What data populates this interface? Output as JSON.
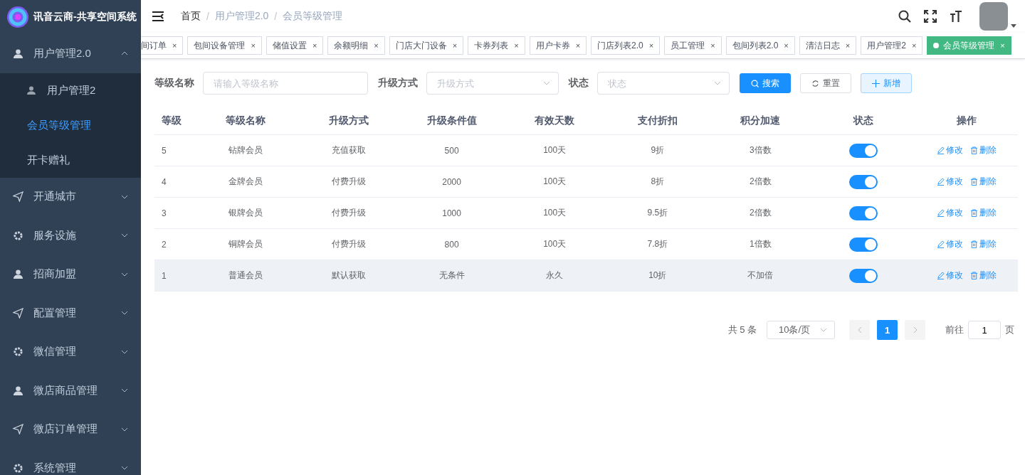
{
  "app": {
    "title": "讯音云商-共享空间系统"
  },
  "sidebar": {
    "items": [
      {
        "label": "用户管理2.0",
        "expanded": true,
        "children": [
          {
            "label": "用户管理2",
            "selected": false,
            "has_icon": true
          },
          {
            "label": "会员等级管理",
            "selected": true,
            "has_icon": false
          },
          {
            "label": "开卡赠礼",
            "selected": false,
            "has_icon": false
          }
        ]
      },
      {
        "label": "开通城市",
        "expanded": false
      },
      {
        "label": "服务设施",
        "expanded": false
      },
      {
        "label": "招商加盟",
        "expanded": false
      },
      {
        "label": "配置管理",
        "expanded": false
      },
      {
        "label": "微信管理",
        "expanded": false
      },
      {
        "label": "微店商品管理",
        "expanded": false
      },
      {
        "label": "微店订单管理",
        "expanded": false
      },
      {
        "label": "系统管理",
        "expanded": false
      }
    ]
  },
  "breadcrumb": {
    "separator": "/",
    "items": [
      {
        "label": "首页",
        "current": false
      },
      {
        "label": "用户管理2.0",
        "current": true
      },
      {
        "label": "会员等级管理",
        "current": true
      }
    ]
  },
  "tabs": [
    {
      "label": "间订单",
      "close": "×",
      "selected": false
    },
    {
      "label": "包间设备管理",
      "close": "×",
      "selected": false
    },
    {
      "label": "储值设置",
      "close": "×",
      "selected": false
    },
    {
      "label": "余额明细",
      "close": "×",
      "selected": false
    },
    {
      "label": "门店大门设备",
      "close": "×",
      "selected": false
    },
    {
      "label": "卡券列表",
      "close": "×",
      "selected": false
    },
    {
      "label": "用户卡券",
      "close": "×",
      "selected": false
    },
    {
      "label": "门店列表2.0",
      "close": "×",
      "selected": false
    },
    {
      "label": "员工管理",
      "close": "×",
      "selected": false
    },
    {
      "label": "包间列表2.0",
      "close": "×",
      "selected": false
    },
    {
      "label": "清洁日志",
      "close": "×",
      "selected": false
    },
    {
      "label": "用户管理2",
      "close": "×",
      "selected": false
    },
    {
      "label": "会员等级管理",
      "close": "×",
      "selected": true
    }
  ],
  "filters": [
    {
      "kind": "input",
      "label": "等级名称",
      "placeholder": "请输入等级名称"
    },
    {
      "kind": "select",
      "label": "升级方式",
      "placeholder": "升级方式"
    },
    {
      "kind": "select",
      "label": "状态",
      "placeholder": "状态"
    }
  ],
  "buttons": [
    {
      "kind": "search",
      "label": "搜索"
    },
    {
      "kind": "reset",
      "label": "重置"
    },
    {
      "kind": "add",
      "label": "新增"
    }
  ],
  "table": {
    "columns": [
      "等级",
      "等级名称",
      "升级方式",
      "升级条件值",
      "有效天数",
      "支付折扣",
      "积分加速",
      "状态",
      "操作"
    ],
    "rows": [
      {
        "cells": [
          "5",
          "钻牌会员",
          "充值获取",
          "500",
          "100天",
          "9折",
          "3倍数"
        ],
        "on": true,
        "hovered": false,
        "edit": "修改",
        "delete": "删除"
      },
      {
        "cells": [
          "4",
          "金牌会员",
          "付费升级",
          "2000",
          "100天",
          "8折",
          "2倍数"
        ],
        "on": true,
        "hovered": false,
        "edit": "修改",
        "delete": "删除"
      },
      {
        "cells": [
          "3",
          "银牌会员",
          "付费升级",
          "1000",
          "100天",
          "9.5折",
          "2倍数"
        ],
        "on": true,
        "hovered": false,
        "edit": "修改",
        "delete": "删除"
      },
      {
        "cells": [
          "2",
          "铜牌会员",
          "付费升级",
          "800",
          "100天",
          "7.8折",
          "1倍数"
        ],
        "on": true,
        "hovered": false,
        "edit": "修改",
        "delete": "删除"
      },
      {
        "cells": [
          "1",
          "普通会员",
          "默认获取",
          "无条件",
          "永久",
          "10折",
          "不加倍"
        ],
        "on": true,
        "hovered": true,
        "edit": "修改",
        "delete": "删除"
      }
    ]
  },
  "pagination": {
    "total": "共 5 条",
    "page_size": "10条/页",
    "pages": [
      {
        "label": "1",
        "selected": true
      }
    ],
    "goto_label": "前往",
    "goto_value": "1",
    "goto_suffix": "页"
  }
}
